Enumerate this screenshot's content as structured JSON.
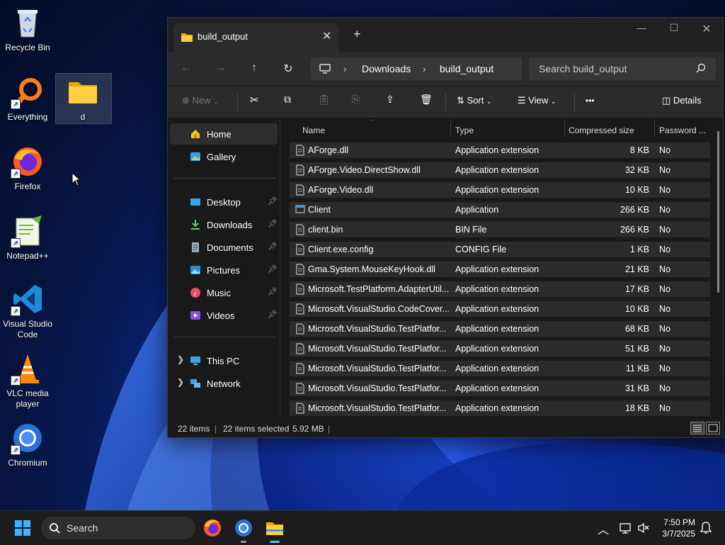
{
  "desktop": {
    "icons": [
      {
        "label": "Recycle Bin"
      },
      {
        "label": "Everything"
      },
      {
        "label": "d"
      },
      {
        "label": "Firefox"
      },
      {
        "label": "Notepad++"
      },
      {
        "label": "Visual Studio Code"
      },
      {
        "label": "VLC media player"
      },
      {
        "label": "Chromium"
      }
    ]
  },
  "explorer": {
    "tab_title": "build_output",
    "breadcrumb": [
      "Downloads",
      "build_output"
    ],
    "search_placeholder": "Search build_output",
    "toolbar": {
      "new": "New",
      "sort": "Sort",
      "view": "View",
      "more": "•••",
      "details": "Details"
    },
    "nav": {
      "home": "Home",
      "gallery": "Gallery",
      "desktop": "Desktop",
      "downloads": "Downloads",
      "documents": "Documents",
      "pictures": "Pictures",
      "music": "Music",
      "videos": "Videos",
      "this_pc": "This PC",
      "network": "Network"
    },
    "columns": {
      "name": "Name",
      "type": "Type",
      "compressed_size": "Compressed size",
      "password": "Password ..."
    },
    "files": [
      {
        "name": "AForge.dll",
        "type": "Application extension",
        "size": "8 KB",
        "password": "No"
      },
      {
        "name": "AForge.Video.DirectShow.dll",
        "type": "Application extension",
        "size": "32 KB",
        "password": "No"
      },
      {
        "name": "AForge.Video.dll",
        "type": "Application extension",
        "size": "10 KB",
        "password": "No"
      },
      {
        "name": "Client",
        "type": "Application",
        "size": "266 KB",
        "password": "No"
      },
      {
        "name": "client.bin",
        "type": "BIN File",
        "size": "266 KB",
        "password": "No"
      },
      {
        "name": "Client.exe.config",
        "type": "CONFIG File",
        "size": "1 KB",
        "password": "No"
      },
      {
        "name": "Gma.System.MouseKeyHook.dll",
        "type": "Application extension",
        "size": "21 KB",
        "password": "No"
      },
      {
        "name": "Microsoft.TestPlatform.AdapterUtil...",
        "type": "Application extension",
        "size": "17 KB",
        "password": "No"
      },
      {
        "name": "Microsoft.VisualStudio.CodeCover...",
        "type": "Application extension",
        "size": "10 KB",
        "password": "No"
      },
      {
        "name": "Microsoft.VisualStudio.TestPlatfor...",
        "type": "Application extension",
        "size": "68 KB",
        "password": "No"
      },
      {
        "name": "Microsoft.VisualStudio.TestPlatfor...",
        "type": "Application extension",
        "size": "51 KB",
        "password": "No"
      },
      {
        "name": "Microsoft.VisualStudio.TestPlatfor...",
        "type": "Application extension",
        "size": "11 KB",
        "password": "No"
      },
      {
        "name": "Microsoft.VisualStudio.TestPlatfor...",
        "type": "Application extension",
        "size": "31 KB",
        "password": "No"
      },
      {
        "name": "Microsoft.VisualStudio.TestPlatfor...",
        "type": "Application extension",
        "size": "18 KB",
        "password": "No"
      }
    ],
    "status": {
      "items": "22 items",
      "selected": "22 items selected",
      "size": "5.92 MB"
    }
  },
  "taskbar": {
    "search_placeholder": "Search",
    "time": "7:50 PM",
    "date": "3/7/2025"
  },
  "colors": {
    "accent": "#4cc2ff",
    "row_bg": "#2b2b2b",
    "window_bg": "#191919"
  }
}
